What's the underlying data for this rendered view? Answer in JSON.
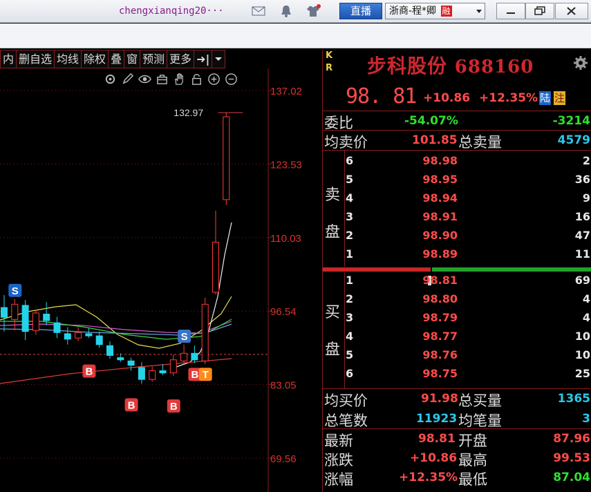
{
  "titlebar": {
    "username": "chengxianqing20···",
    "live_label": "直播",
    "broker_label": "浙商-程*卿",
    "broker_badge": "融"
  },
  "chart_menu": {
    "items": [
      "内",
      "删自选",
      "均线",
      "除权",
      "叠",
      "窗",
      "预测",
      "更多"
    ],
    "arrow_label": "➜|"
  },
  "chart_data": {
    "type": "candlestick",
    "y_ticks": [
      "137.02",
      "123.53",
      "110.03",
      "96.54",
      "83.05",
      "69.56"
    ],
    "ylim": [
      69.56,
      137.02
    ],
    "high_marker": "132.97",
    "last_price_line": 88.6,
    "candles": [
      {
        "o": 97.2,
        "h": 99.5,
        "l": 92.8,
        "c": 95.4,
        "up": false
      },
      {
        "o": 95.0,
        "h": 98.8,
        "l": 93.0,
        "c": 97.8,
        "up": true
      },
      {
        "o": 97.6,
        "h": 98.6,
        "l": 91.2,
        "c": 92.8,
        "up": false
      },
      {
        "o": 93.0,
        "h": 96.8,
        "l": 92.2,
        "c": 96.2,
        "up": true
      },
      {
        "o": 96.0,
        "h": 98.2,
        "l": 93.9,
        "c": 94.8,
        "up": false
      },
      {
        "o": 94.4,
        "h": 95.5,
        "l": 91.6,
        "c": 92.6,
        "up": false
      },
      {
        "o": 92.4,
        "h": 93.6,
        "l": 90.4,
        "c": 91.4,
        "up": false
      },
      {
        "o": 91.6,
        "h": 93.6,
        "l": 91.0,
        "c": 92.6,
        "up": true
      },
      {
        "o": 92.4,
        "h": 93.4,
        "l": 91.6,
        "c": 92.0,
        "up": false
      },
      {
        "o": 92.0,
        "h": 92.8,
        "l": 89.8,
        "c": 90.4,
        "up": false
      },
      {
        "o": 90.2,
        "h": 91.0,
        "l": 87.8,
        "c": 88.4,
        "up": false
      },
      {
        "o": 88.0,
        "h": 88.8,
        "l": 87.2,
        "c": 87.6,
        "up": false
      },
      {
        "o": 87.4,
        "h": 88.0,
        "l": 85.6,
        "c": 86.6,
        "up": false
      },
      {
        "o": 86.2,
        "h": 87.2,
        "l": 83.2,
        "c": 84.0,
        "up": false
      },
      {
        "o": 84.0,
        "h": 86.4,
        "l": 83.6,
        "c": 85.6,
        "up": true
      },
      {
        "o": 85.6,
        "h": 86.8,
        "l": 84.8,
        "c": 85.2,
        "up": false
      },
      {
        "o": 85.2,
        "h": 88.6,
        "l": 84.6,
        "c": 87.6,
        "up": true
      },
      {
        "o": 87.4,
        "h": 90.4,
        "l": 86.8,
        "c": 88.8,
        "up": true
      },
      {
        "o": 88.8,
        "h": 90.2,
        "l": 87.0,
        "c": 87.6,
        "up": false
      },
      {
        "o": 87.4,
        "h": 99.0,
        "l": 86.8,
        "c": 97.8,
        "up": true
      },
      {
        "o": 100.0,
        "h": 115.0,
        "l": 99.6,
        "c": 109.2,
        "up": true
      },
      {
        "o": 117.0,
        "h": 132.97,
        "l": 116.0,
        "c": 132.2,
        "up": true
      }
    ],
    "markers": [
      "S",
      "S",
      "B",
      "B",
      "B",
      "B",
      "T"
    ]
  },
  "panel": {
    "kr": [
      "K",
      "R"
    ],
    "stock_name": "步科股份",
    "stock_code": "688160",
    "last_price": "98. 81",
    "change": "+10.86",
    "change_pct": "+12.35%",
    "tag_lu": "陆",
    "tag_zhu": "注",
    "weibi_label": "委比",
    "weibi_pct": "-54.07%",
    "weibi_diff": "-3214",
    "avg_sell_label": "均卖价",
    "avg_sell_price": "101.85",
    "total_sell_label": "总卖量",
    "total_sell_qty": "4579",
    "sell_side": [
      "卖",
      "盘"
    ],
    "buy_side": [
      "买",
      "盘"
    ],
    "asks": [
      {
        "level": "6",
        "price": "98.98",
        "qty": "2"
      },
      {
        "level": "5",
        "price": "98.95",
        "qty": "36"
      },
      {
        "level": "4",
        "price": "98.94",
        "qty": "9"
      },
      {
        "level": "3",
        "price": "98.91",
        "qty": "16"
      },
      {
        "level": "2",
        "price": "98.90",
        "qty": "47"
      },
      {
        "level": "1",
        "price": "98.89",
        "qty": "11"
      }
    ],
    "bids": [
      {
        "level": "1",
        "price": "98.81",
        "qty": "69"
      },
      {
        "level": "2",
        "price": "98.80",
        "qty": "4"
      },
      {
        "level": "3",
        "price": "98.79",
        "qty": "4"
      },
      {
        "level": "4",
        "price": "98.77",
        "qty": "10"
      },
      {
        "level": "5",
        "price": "98.76",
        "qty": "10"
      },
      {
        "level": "6",
        "price": "98.75",
        "qty": "25"
      }
    ],
    "avg_buy_label": "均买价",
    "avg_buy_price": "91.98",
    "total_buy_label": "总买量",
    "total_buy_qty": "1365",
    "total_trades_label": "总笔数",
    "total_trades": "11923",
    "avg_trade_label": "均笔量",
    "avg_trade": "3",
    "latest_label": "最新",
    "latest": "98.81",
    "open_label": "开盘",
    "open": "87.96",
    "change_label": "涨跌",
    "change2": "+10.86",
    "high_label": "最高",
    "high": "99.53",
    "pct_label": "涨幅",
    "pct2": "+12.35%",
    "low_label": "最低",
    "low": "87.04"
  },
  "colors": {
    "up": "#ff3b3b",
    "down": "#25d3e8",
    "grid": "#8b1d1d"
  }
}
